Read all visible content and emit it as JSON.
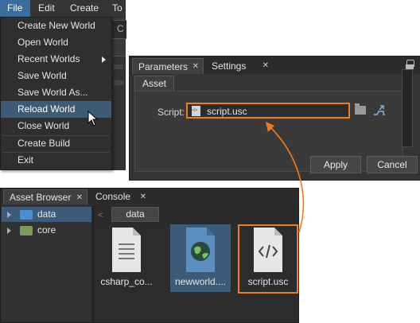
{
  "menubar": {
    "items": [
      "File",
      "Edit",
      "Create",
      "To"
    ]
  },
  "file_menu": {
    "items": [
      {
        "label": "Create New World"
      },
      {
        "label": "Open World"
      },
      {
        "label": "Recent Worlds"
      },
      {
        "label": "Save World"
      },
      {
        "label": "Save World As..."
      },
      {
        "label": "Reload World"
      },
      {
        "label": "Close World"
      },
      {
        "label": "Create Build"
      },
      {
        "label": "Exit"
      }
    ],
    "highlighted": "Reload World"
  },
  "toolbar_fragment": "C",
  "parameters_window": {
    "tabs": [
      "Parameters",
      "Settings"
    ],
    "subtab": "Asset",
    "script_label": "Script:",
    "script_value": "script.usc",
    "apply_label": "Apply",
    "cancel_label": "Cancel"
  },
  "asset_browser": {
    "tabs": [
      "Asset Browser",
      "Console"
    ],
    "tree": [
      {
        "label": "data",
        "selected": true,
        "icon": "folder-icon"
      },
      {
        "label": "core",
        "selected": false,
        "icon": "folder-lock-icon"
      }
    ],
    "path": "data",
    "files": [
      {
        "name": "csharp_co...",
        "icon": "text-document-icon"
      },
      {
        "name": "newworld....",
        "icon": "world-file-icon"
      },
      {
        "name": "script.usc",
        "icon": "code-file-icon"
      }
    ]
  },
  "colors": {
    "highlight_orange": "#f07d1a",
    "selection_blue": "#3d5a77"
  }
}
